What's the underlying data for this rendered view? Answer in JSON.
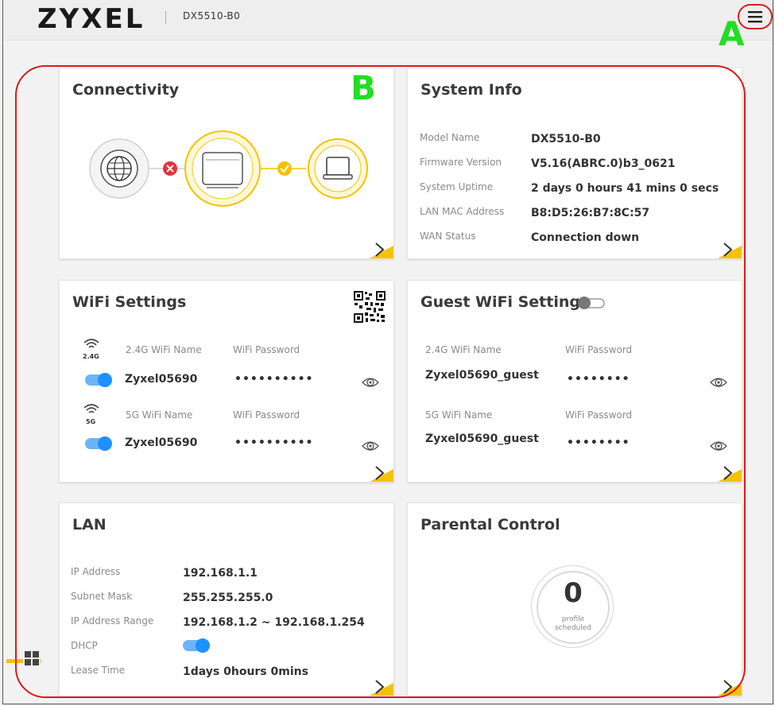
{
  "header": {
    "logo_text": "ZYXEL",
    "model": "DX5510-B0",
    "menu_icon": "hamburger-menu-icon"
  },
  "annotations": {
    "a": "A",
    "b": "B"
  },
  "connectivity": {
    "title": "Connectivity",
    "nodes": [
      "globe-icon",
      "router-icon",
      "laptop-icon"
    ],
    "link1_status": "error",
    "link2_status": "ok"
  },
  "system_info": {
    "title": "System Info",
    "rows": [
      {
        "label": "Model Name",
        "value": "DX5510-B0"
      },
      {
        "label": "Firmware Version",
        "value": "V5.16(ABRC.0)b3_0621"
      },
      {
        "label": "System Uptime",
        "value": "2 days 0 hours 41 mins 0 secs"
      },
      {
        "label": "LAN MAC Address",
        "value": "B8:D5:26:B7:8C:57"
      },
      {
        "label": "WAN Status",
        "value": "Connection down"
      }
    ]
  },
  "wifi": {
    "title": "WiFi Settings",
    "band24": {
      "badge": "2.4G",
      "name_label": "2.4G WiFi Name",
      "pw_label": "WiFi Password",
      "name": "Zyxel05690",
      "password": "••••••••••"
    },
    "band5": {
      "badge": "5G",
      "name_label": "5G WiFi Name",
      "pw_label": "WiFi Password",
      "name": "Zyxel05690",
      "password": "••••••••••"
    }
  },
  "guest_wifi": {
    "title": "Guest WiFi Settings",
    "band24": {
      "name_label": "2.4G WiFi Name",
      "pw_label": "WiFi Password",
      "name": "Zyxel05690_guest",
      "password": "••••••••"
    },
    "band5": {
      "name_label": "5G WiFi Name",
      "pw_label": "WiFi Password",
      "name": "Zyxel05690_guest",
      "password": "••••••••"
    }
  },
  "lan": {
    "title": "LAN",
    "rows": [
      {
        "label": "IP Address",
        "value": "192.168.1.1"
      },
      {
        "label": "Subnet Mask",
        "value": "255.255.255.0"
      },
      {
        "label": "IP Address Range",
        "value": "192.168.1.2 ~ 192.168.1.254"
      },
      {
        "label": "DHCP",
        "value": ""
      },
      {
        "label": "Lease Time",
        "value": "1days 0hours 0mins"
      }
    ]
  },
  "parental": {
    "title": "Parental Control",
    "count": "0",
    "caption1": "profile",
    "caption2": "scheduled"
  },
  "colors": {
    "accent_yellow": "#f5c200",
    "toggle_blue": "#1e90ff",
    "error_red": "#e8303a",
    "annotation_green": "#22dd22",
    "annotation_red": "#e01818"
  }
}
